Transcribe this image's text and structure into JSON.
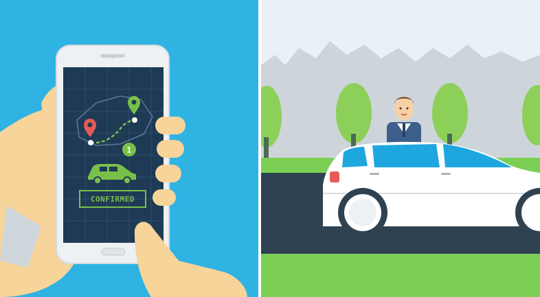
{
  "phone": {
    "status_text": "CONFIRMED",
    "badge_count": "1"
  },
  "colors": {
    "left_background": "#2fb3e3",
    "phone_body": "#eef1f3",
    "phone_screen": "#1e3a55",
    "accent_green": "#79c04a",
    "pin_red": "#e65a57",
    "hand_skin": "#f6d49a",
    "sky": "#e9f1f6",
    "tree_green": "#8cd05a",
    "road": "#2f4252",
    "grass": "#7ccf55",
    "car_body": "#ffffff",
    "car_window": "#1ea7df"
  },
  "icons": {
    "destination_pin": "map-pin-icon",
    "origin_pin": "map-pin-icon",
    "car": "car-icon"
  }
}
